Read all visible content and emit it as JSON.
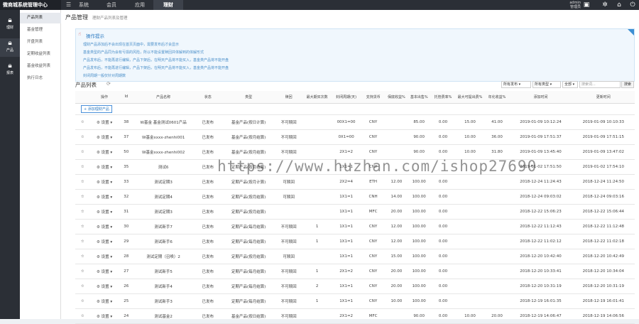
{
  "topbar": {
    "logo": "微商城系统管理中心",
    "nav": [
      {
        "label": "系统",
        "active": false
      },
      {
        "label": "会员",
        "active": false
      },
      {
        "label": "应用",
        "active": false
      },
      {
        "label": "理财",
        "active": true
      }
    ],
    "user_line1": "admin",
    "user_line2": "管理员"
  },
  "sidebar": {
    "items": [
      {
        "label": "理财",
        "icon": "lock-icon",
        "active": false
      },
      {
        "label": "产品",
        "icon": "lock-icon",
        "active": true
      },
      {
        "label": "报表",
        "icon": "lock-icon",
        "active": false
      }
    ]
  },
  "submenu": {
    "items": [
      {
        "label": "产品列表",
        "active": true
      },
      {
        "label": "基金管理",
        "active": false
      },
      {
        "label": "开盘列表",
        "active": false
      },
      {
        "label": "定期收益列表",
        "active": false
      },
      {
        "label": "基金收益列表",
        "active": false
      },
      {
        "label": "执行日志",
        "active": false
      }
    ]
  },
  "breadcrumb": {
    "title": "产品管理",
    "subtitle": "理财产品列表及管理"
  },
  "tips": {
    "title": "操作提示",
    "lines": [
      "理财产品添加后不会出现在首页页面中，需要发布后才会显示",
      "基金类型的产品同为会有亏损的风险，所以不能设置赎回并体解到的体解形式",
      "产品发布后，不能再进行编辑，产品下架后，在明天产品将不能买入，基金类产品将不能开盘",
      "产品发布后，不能再进行编辑，产品下架后，在明天产品将不能买入，基金类产品将不能开盘",
      "封闭周期一般仅针对周期数"
    ]
  },
  "list": {
    "title": "产品列表",
    "filter_status": "所有发布",
    "filter_type": "所有类型",
    "filter_all": "全部",
    "search_placeholder": "搜索词...",
    "search_button": "搜索",
    "add_button": "添加理财产品"
  },
  "table": {
    "headers": [
      "",
      "操作",
      "Id",
      "产品名称",
      "状态",
      "类型",
      "赎回",
      "最大期买次数",
      "封闭周期(天)",
      "支持货币",
      "保底收益%",
      "基本出售%",
      "托管费率%",
      "最大可提出费%",
      "年化收益%",
      "添加时间",
      "更新时间"
    ],
    "rows": [
      [
        "☆",
        "设置",
        "38",
        "W基金 基金测试0601产品",
        "已发布",
        "基金产品(按日计算)",
        "不可赎回",
        "",
        "00X1=00",
        "CNY",
        "",
        "85.00",
        "0.00",
        "15.00",
        "41.00",
        "2019-01-09 10:12:24",
        "2019-01-09 10:10:33"
      ],
      [
        "☆",
        "设置",
        "37",
        "W基金xxxx-zhenhi001",
        "已发布",
        "基金产品(按月结算)",
        "不可赎回",
        "",
        "0X1=00",
        "CNY",
        "",
        "90.00",
        "0.00",
        "10.00",
        "36.00",
        "2019-01-09 17:51:37",
        "2019-01-09 17:51:15"
      ],
      [
        "☆",
        "设置",
        "50",
        "W基金xxxx-zhenhi002",
        "已发布",
        "基金产品(按月结算)",
        "不可赎回",
        "",
        "2X1=2",
        "CNY",
        "",
        "90.00",
        "0.00",
        "10.00",
        "31.80",
        "2019-01-09 13:45:40",
        "2019-01-09 13:47:02"
      ],
      [
        "☆",
        "设置",
        "35",
        "测试6",
        "已发布",
        "定期产品(按月结算)",
        "",
        "",
        "1X1=1",
        "CNY",
        "",
        "",
        "",
        "",
        "",
        "2019-01-02 17:51:50",
        "2019-01-02 17:54:10"
      ],
      [
        "☆",
        "设置",
        "33",
        "测试定期3",
        "已发布",
        "定期产品(按月计算)",
        "可赎回",
        "",
        "2X2=4",
        "ETH",
        "12.00",
        "100.00",
        "0.00",
        "",
        "",
        "2018-12-24 11:24:43",
        "2018-12-24 11:24:50"
      ],
      [
        "☆",
        "设置",
        "32",
        "测试定期4",
        "已发布",
        "定期产品(按月结算)",
        "可赎回",
        "",
        "1X1=1",
        "CNH",
        "14.00",
        "100.00",
        "0.00",
        "",
        "",
        "2018-12-24 09:03:02",
        "2018-12-24 09:03:16"
      ],
      [
        "☆",
        "设置",
        "31",
        "测试定期3",
        "已发布",
        "定期产品(按月结算)",
        "",
        "",
        "1X1=1",
        "MFC",
        "20.00",
        "100.00",
        "0.00",
        "",
        "",
        "2018-12-22 15:06:23",
        "2018-12-22 15:06:44"
      ],
      [
        "☆",
        "设置",
        "30",
        "测试新手7",
        "已发布",
        "定期产品(每月结算)",
        "不可赎回",
        "1",
        "1X1=1",
        "CNY",
        "12.00",
        "100.00",
        "0.00",
        "",
        "",
        "2018-12-22 11:12:43",
        "2018-12-22 11:12:48"
      ],
      [
        "☆",
        "设置",
        "29",
        "测试新手6",
        "已发布",
        "定期产品(每月结算)",
        "不可赎回",
        "1",
        "1X1=1",
        "CNY",
        "12.00",
        "100.00",
        "0.00",
        "",
        "",
        "2018-12-22 11:02:12",
        "2018-12-22 11:02:18"
      ],
      [
        "☆",
        "设置",
        "28",
        "测试定期（召唤）2",
        "已发布",
        "定期产品(按月结算)",
        "可赎回",
        "",
        "1X1=1",
        "CNY",
        "15.00",
        "100.00",
        "0.00",
        "",
        "",
        "2018-12-20 10:42:40",
        "2018-12-20 10:42:49"
      ],
      [
        "☆",
        "设置",
        "27",
        "测试新手5",
        "已发布",
        "定期产品(每月结算)",
        "不可赎回",
        "1",
        "2X1=2",
        "CNY",
        "20.00",
        "100.00",
        "0.00",
        "",
        "",
        "2018-12-20 10:33:41",
        "2018-12-20 10:34:04"
      ],
      [
        "☆",
        "设置",
        "26",
        "测试新手4",
        "已发布",
        "定期产品(每月结算)",
        "不可赎回",
        "2",
        "1X1=1",
        "CNY",
        "20.00",
        "100.00",
        "0.00",
        "",
        "",
        "2018-12-20 10:31:19",
        "2018-12-20 10:31:19"
      ],
      [
        "☆",
        "设置",
        "25",
        "测试新手3",
        "已发布",
        "定期产品(每月结算)",
        "不可赎回",
        "1",
        "1X1=1",
        "CNY",
        "10.00",
        "100.00",
        "0.00",
        "",
        "",
        "2018-12-19 16:01:35",
        "2018-12-19 16:01:41"
      ],
      [
        "☆",
        "设置",
        "24",
        "测试基金2",
        "已发布",
        "基金产品(按日结算)",
        "不可赎回",
        "",
        "2X1=2",
        "MFC",
        "",
        "90.00",
        "0.00",
        "10.00",
        "20.00",
        "2018-12-19 14:06:47",
        "2018-12-19 14:06:56"
      ]
    ]
  },
  "watermark": "https://www.huzhan.com/ishop27690"
}
